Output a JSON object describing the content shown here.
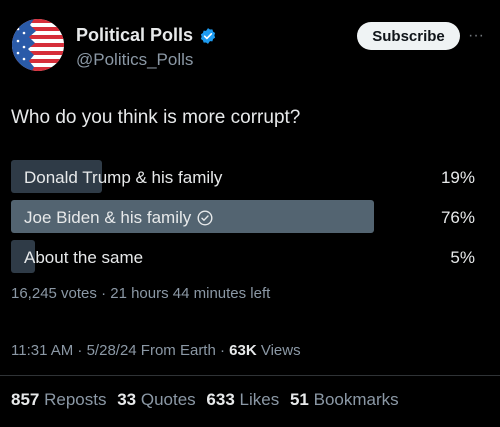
{
  "author": {
    "display_name": "Political Polls",
    "handle": "@Politics_Polls",
    "avatar_icon": "us-flag-circle-icon",
    "verified_icon": "verified-badge-icon",
    "verified_color": "#1d9bf0"
  },
  "header": {
    "subscribe_label": "Subscribe",
    "more_label": "···"
  },
  "tweet": {
    "text": "Who do you think is more corrupt?"
  },
  "poll": {
    "options": [
      {
        "label": "Donald Trump & his family",
        "percent_label": "19%",
        "percent": 19,
        "selected": false
      },
      {
        "label": "Joe Biden & his family",
        "percent_label": "76%",
        "percent": 76,
        "selected": true
      },
      {
        "label": "About the same",
        "percent_label": "5%",
        "percent": 5,
        "selected": false
      }
    ],
    "meta": "16,245 votes · 21 hours 44 minutes left",
    "bar_color": "#2f3b47",
    "leader_bar_color": "#536471"
  },
  "timestamp": {
    "text": "11:31 AM · 5/28/24 From Earth · ",
    "views_count": "63K",
    "views_label": " Views"
  },
  "stats": {
    "reposts_count": "857",
    "reposts_label": "Reposts",
    "quotes_count": "33",
    "quotes_label": "Quotes",
    "likes_count": "633",
    "likes_label": "Likes",
    "bookmarks_count": "51",
    "bookmarks_label": "Bookmarks"
  }
}
